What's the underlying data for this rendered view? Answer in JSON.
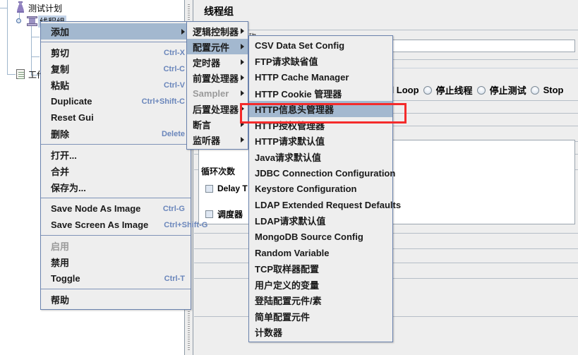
{
  "tree": {
    "nodes": [
      {
        "label": "测试计划",
        "icon": "test-plan-flask-icon",
        "selected": false
      },
      {
        "label": "线程组",
        "icon": "thread-group-spool-icon",
        "selected": true
      },
      {
        "label": "",
        "icon": "http-sampler-pencil-icon",
        "selected": false
      },
      {
        "label": "",
        "icon": "listener-color-icon",
        "selected": false
      },
      {
        "label": "",
        "icon": "http-sampler-pencil-icon",
        "selected": false
      },
      {
        "label": "工作台",
        "icon": "workbench-icon",
        "selected": false
      }
    ]
  },
  "right_panel": {
    "title": "线程组",
    "name_label": "名称",
    "loop_count_label": "循环次数",
    "delay_checkbox_label": "Delay T",
    "scheduler_checkbox_label": "调度器",
    "action_row": {
      "prefix_label": "ad Loop",
      "options": [
        "停止线程",
        "停止测试",
        "Stop"
      ]
    }
  },
  "context_menu": {
    "name": "node-context-menu",
    "groups": [
      [
        {
          "label": "添加",
          "accel": "",
          "submenu": true,
          "selected": true,
          "disabled": false
        }
      ],
      [
        {
          "label": "剪切",
          "accel": "Ctrl-X",
          "submenu": false,
          "selected": false,
          "disabled": false
        },
        {
          "label": "复制",
          "accel": "Ctrl-C",
          "submenu": false,
          "selected": false,
          "disabled": false
        },
        {
          "label": "粘贴",
          "accel": "Ctrl-V",
          "submenu": false,
          "selected": false,
          "disabled": false
        },
        {
          "label": "Duplicate",
          "accel": "Ctrl+Shift-C",
          "submenu": false,
          "selected": false,
          "disabled": false
        },
        {
          "label": "Reset Gui",
          "accel": "",
          "submenu": false,
          "selected": false,
          "disabled": false
        },
        {
          "label": "删除",
          "accel": "Delete",
          "submenu": false,
          "selected": false,
          "disabled": false
        }
      ],
      [
        {
          "label": "打开...",
          "accel": "",
          "submenu": false,
          "selected": false,
          "disabled": false
        },
        {
          "label": "合并",
          "accel": "",
          "submenu": false,
          "selected": false,
          "disabled": false
        },
        {
          "label": "保存为...",
          "accel": "",
          "submenu": false,
          "selected": false,
          "disabled": false
        }
      ],
      [
        {
          "label": "Save Node As Image",
          "accel": "Ctrl-G",
          "submenu": false,
          "selected": false,
          "disabled": false
        },
        {
          "label": "Save Screen As Image",
          "accel": "Ctrl+Shift-G",
          "submenu": false,
          "selected": false,
          "disabled": false
        }
      ],
      [
        {
          "label": "启用",
          "accel": "",
          "submenu": false,
          "selected": false,
          "disabled": true
        },
        {
          "label": "禁用",
          "accel": "",
          "submenu": false,
          "selected": false,
          "disabled": false
        },
        {
          "label": "Toggle",
          "accel": "Ctrl-T",
          "submenu": false,
          "selected": false,
          "disabled": false
        }
      ],
      [
        {
          "label": "帮助",
          "accel": "",
          "submenu": false,
          "selected": false,
          "disabled": false
        }
      ]
    ]
  },
  "add_submenu": {
    "name": "add-submenu",
    "items": [
      {
        "label": "逻辑控制器",
        "submenu": true,
        "selected": false,
        "disabled": false
      },
      {
        "label": "配置元件",
        "submenu": true,
        "selected": true,
        "disabled": false
      },
      {
        "label": "定时器",
        "submenu": true,
        "selected": false,
        "disabled": false
      },
      {
        "label": "前置处理器",
        "submenu": true,
        "selected": false,
        "disabled": false
      },
      {
        "label": "Sampler",
        "submenu": true,
        "selected": false,
        "disabled": true
      },
      {
        "label": "后置处理器",
        "submenu": true,
        "selected": false,
        "disabled": false
      },
      {
        "label": "断言",
        "submenu": true,
        "selected": false,
        "disabled": false
      },
      {
        "label": "监听器",
        "submenu": true,
        "selected": false,
        "disabled": false
      }
    ]
  },
  "config_submenu": {
    "name": "config-element-submenu",
    "items": [
      {
        "label": "CSV Data Set Config",
        "selected": false
      },
      {
        "label": "FTP请求缺省值",
        "selected": false
      },
      {
        "label": "HTTP Cache Manager",
        "selected": false
      },
      {
        "label": "HTTP Cookie 管理器",
        "selected": false
      },
      {
        "label": "HTTP信息头管理器",
        "selected": true
      },
      {
        "label": "HTTP授权管理器",
        "selected": false
      },
      {
        "label": "HTTP请求默认值",
        "selected": false
      },
      {
        "label": "Java请求默认值",
        "selected": false
      },
      {
        "label": "JDBC Connection Configuration",
        "selected": false
      },
      {
        "label": "Keystore Configuration",
        "selected": false
      },
      {
        "label": "LDAP Extended Request Defaults",
        "selected": false
      },
      {
        "label": "LDAP请求默认值",
        "selected": false
      },
      {
        "label": "MongoDB Source Config",
        "selected": false
      },
      {
        "label": "Random Variable",
        "selected": false
      },
      {
        "label": "TCP取样器配置",
        "selected": false
      },
      {
        "label": "用户定义的变量",
        "selected": false
      },
      {
        "label": "登陆配置元件/素",
        "selected": false
      },
      {
        "label": "简单配置元件",
        "selected": false
      },
      {
        "label": "计数器",
        "selected": false
      }
    ]
  },
  "annotation": {
    "name": "red-highlight-box",
    "color": "#f42b2b"
  }
}
